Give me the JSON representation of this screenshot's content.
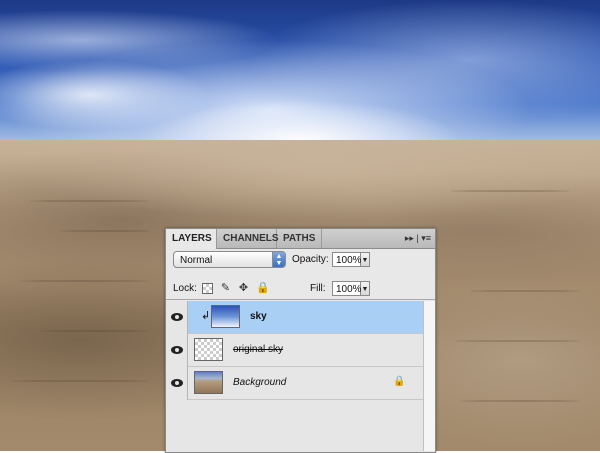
{
  "panel": {
    "tabs": [
      {
        "label": "LAYERS",
        "active": true
      },
      {
        "label": "CHANNELS",
        "active": false
      },
      {
        "label": "PATHS",
        "active": false
      }
    ],
    "menu_glyph": "▸▸ | ▾≡",
    "blend_mode": "Normal",
    "opacity_label": "Opacity:",
    "opacity_value": "100%",
    "lock_label": "Lock:",
    "fill_label": "Fill:",
    "fill_value": "100%"
  },
  "layers": [
    {
      "name": "sky",
      "selected": true,
      "visible": true,
      "clipped": true,
      "thumbnail": "sky-photo"
    },
    {
      "name": "original sky",
      "selected": false,
      "visible": true,
      "clipped": false,
      "thumbnail": "transparent",
      "strikethrough": true
    },
    {
      "name": "Background",
      "selected": false,
      "visible": true,
      "locked": true,
      "italic": true,
      "thumbnail": "desert-photo"
    }
  ],
  "colors": {
    "selection": "#a9cff5",
    "panel_bg": "#e8e8e8"
  },
  "icons": {
    "eye": "eye-icon",
    "lock": "lock-icon",
    "clip": "clipping-arrow-icon"
  }
}
